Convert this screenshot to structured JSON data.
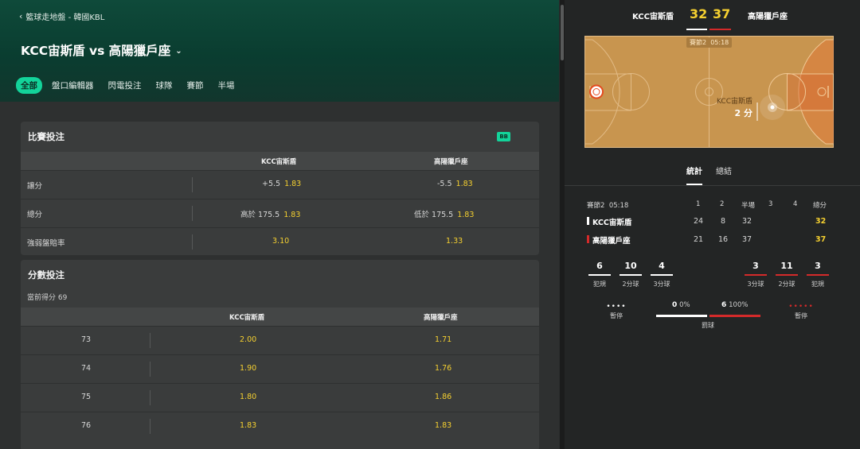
{
  "breadcrumb": {
    "back_icon": "chevron-left-icon",
    "text": "籃球走地盤 - 韓國KBL"
  },
  "match": {
    "title": "KCC宙斯盾 vs 高陽獵戶座",
    "dropdown_icon": "chevron-down-icon"
  },
  "tabs": [
    "全部",
    "盤口編輯器",
    "閃電投注",
    "球隊",
    "賽節",
    "半場"
  ],
  "match_bets": {
    "title": "比賽投注",
    "badge": "BB",
    "home_header": "KCC宙斯盾",
    "away_header": "高陽獵戶座",
    "rows": [
      {
        "label": "讓分",
        "home_line": "+5.5",
        "home_odd": "1.83",
        "away_line": "-5.5",
        "away_odd": "1.83"
      },
      {
        "label": "總分",
        "home_line": "高於 175.5",
        "home_odd": "1.83",
        "away_line": "低於 175.5",
        "away_odd": "1.83"
      },
      {
        "label": "強弱盤賠率",
        "home_line": "",
        "home_odd": "3.10",
        "away_line": "",
        "away_odd": "1.33"
      }
    ]
  },
  "score_bets": {
    "title": "分數投注",
    "current": "當前得分 69",
    "home_header": "KCC宙斯盾",
    "away_header": "高陽獵戶座",
    "rows": [
      {
        "score": "73",
        "home_odd": "2.00",
        "away_odd": "1.71"
      },
      {
        "score": "74",
        "home_odd": "1.90",
        "away_odd": "1.76"
      },
      {
        "score": "75",
        "home_odd": "1.80",
        "away_odd": "1.86"
      },
      {
        "score": "76",
        "home_odd": "1.83",
        "away_odd": "1.83"
      }
    ]
  },
  "scoreboard": {
    "home": "KCC宙斯盾",
    "away": "高陽獵戶座",
    "home_score": "32",
    "away_score": "37",
    "period": "賽節2",
    "clock": "05:18",
    "court_team": "KCC宙斯盾",
    "court_event": "2 分",
    "home_color": "#ffffff",
    "away_color": "#d42a2a"
  },
  "stat_tabs": [
    "統計",
    "總結"
  ],
  "stats_table": {
    "period": "賽節2",
    "clock": "05:18",
    "headers": [
      "1",
      "2",
      "半場",
      "3",
      "4",
      "總分"
    ],
    "rows": [
      {
        "team": "KCC宙斯盾",
        "q1": "24",
        "q2": "8",
        "half": "32",
        "q3": "",
        "q4": "",
        "total": "32"
      },
      {
        "team": "高陽獵戶座",
        "q1": "21",
        "q2": "16",
        "half": "37",
        "q3": "",
        "q4": "",
        "total": "37"
      }
    ]
  },
  "team_stats": {
    "home": [
      {
        "value": "6",
        "label": "犯規"
      },
      {
        "value": "10",
        "label": "2分球"
      },
      {
        "value": "4",
        "label": "3分球"
      }
    ],
    "away": [
      {
        "value": "3",
        "label": "3分球"
      },
      {
        "value": "11",
        "label": "2分球"
      },
      {
        "value": "3",
        "label": "犯規"
      }
    ]
  },
  "timeouts": {
    "label": "暫停",
    "home_dots": "••••",
    "away_dots": "•••••"
  },
  "free_throws": {
    "label": "罰球",
    "home_made": "0",
    "home_pct": "0%",
    "away_made": "6",
    "away_pct": "100%"
  }
}
